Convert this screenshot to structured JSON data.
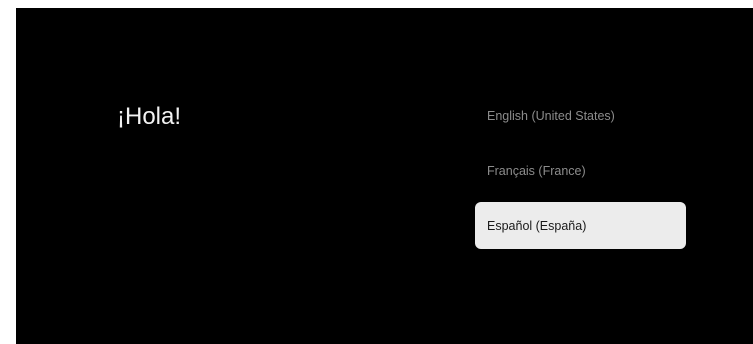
{
  "greeting": "¡Hola!",
  "languages": [
    {
      "label": "English (United States)",
      "selected": false
    },
    {
      "label": "Français (France)",
      "selected": false
    },
    {
      "label": "Español (España)",
      "selected": true
    }
  ],
  "colors": {
    "background": "#000000",
    "greeting_text": "#f2f2f2",
    "item_text": "#8c8c8c",
    "selected_background": "#ececec",
    "selected_text": "#1a1a1a"
  }
}
